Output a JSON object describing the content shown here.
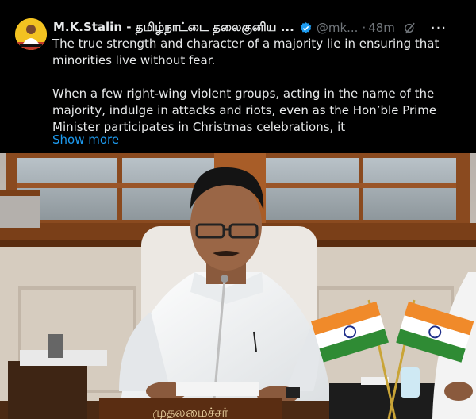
{
  "tweet": {
    "author_name": "M.K.Stalin - தமிழ்நாட்டை தலைகுனிய ...",
    "handle": "@mk...",
    "separator": "·",
    "time": "48m",
    "paragraphs": [
      "The true strength and character of a majority lie in ensuring that minorities live without fear.",
      "When a few right-wing violent groups, acting in the name of the majority, indulge in attacks and riots, even as the Hon’ble Prime Minister participates in Christmas celebrations, it"
    ],
    "show_more": "Show more",
    "more_icon": "more-icon",
    "grok_icon": "grok-icon",
    "verified_icon": "verified-badge-icon"
  },
  "photo": {
    "nameplate_text": "முதலமைச்சர்",
    "flags": [
      "india-flag",
      "india-flag"
    ]
  },
  "colors": {
    "accent": "#1d9bf0",
    "text": "#e7e9ea",
    "muted": "#71767b",
    "background": "#000000"
  }
}
